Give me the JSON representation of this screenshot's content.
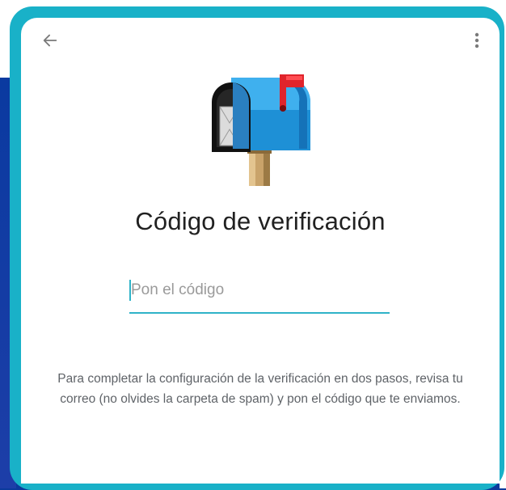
{
  "screen": {
    "title": "Código de verificación",
    "code_input": {
      "value": "",
      "placeholder": "Pon el código"
    },
    "info_text": "Para completar la configuración de la verificación en dos pasos, revisa tu correo (no olvides la carpeta de spam) y pon el código que te enviamos."
  },
  "toolbar": {
    "back_icon": "arrow-back-icon",
    "menu_icon": "more-vert-icon"
  },
  "illustration": {
    "icon": "mailbox-icon"
  },
  "colors": {
    "accent": "#2fb3c8",
    "frame": "#19b1c8",
    "background_band": "#0b3a9c",
    "title_text": "#212121",
    "body_text": "#5f6368",
    "placeholder_text": "#9a9a9a"
  }
}
